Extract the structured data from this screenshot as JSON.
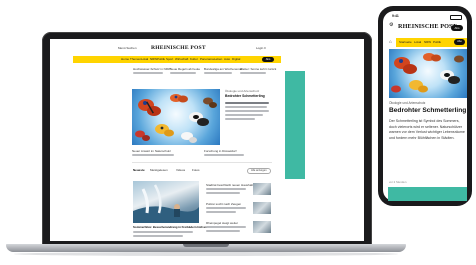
{
  "laptop": {
    "header": {
      "left_text": "Menü  Suchen",
      "logo": "RHEINISCHE POST",
      "right_text": "Login  ≡",
      "nav_items": [
        "Home",
        "Themen",
        "Lokal",
        "NRW",
        "Politik",
        "Sport",
        "Wirtschaft",
        "Kultur",
        "Panorama",
        "Leben",
        "Auto",
        "Digital"
      ],
      "nav_pill": "Abo"
    },
    "teasers": [
      "Hochwasser-Schutz in NRW",
      "Neue Regeln ab heute",
      "Bundesliga am Wochenende",
      "Wetter: Sonne kehrt zurück"
    ],
    "hero": {
      "kicker": "Ökologie und Artenschutz",
      "headline": "Bedrohter Schmetterling"
    },
    "hero_captions": [
      "Neuer Ansatz im Naturschutz",
      "Forschung in Düsseldorf"
    ],
    "section": {
      "tabs": [
        "Neueste",
        "Meistgelesen",
        "Videos",
        "Fotos"
      ],
      "button": "Alle anzeigen",
      "lead_headline": "Sommerhitze: Besucherandrang in Freibädern hält an",
      "items": [
        "Stadtrat beschließt neuen Haushalt",
        "Polizei sucht nach Zeugen",
        "Rheinpegel steigt weiter"
      ]
    }
  },
  "phone": {
    "status_time": "9:41",
    "logo": "RHEINISCHE POST",
    "abo_label": "Abo",
    "nav_items": [
      "Startseite",
      "Lokal",
      "NRW",
      "Politik"
    ],
    "nav_pill": "Abo",
    "kicker": "Ökologie und Artenschutz",
    "headline": "Bedrohter Schmetterling",
    "body": "Der Schmetterling ist Symbol des Sommers, doch vielerorts wird er seltener. Naturschützer warnen vor dem Verlust wichtiger Lebensräume und fordern mehr Blühflächen in Städten.",
    "timestamp": "vor 2 Stunden"
  },
  "colors": {
    "accent_yellow": "#ffd400",
    "ad_teal": "#3fb9a3",
    "sky_blue": "#5aa6db"
  }
}
